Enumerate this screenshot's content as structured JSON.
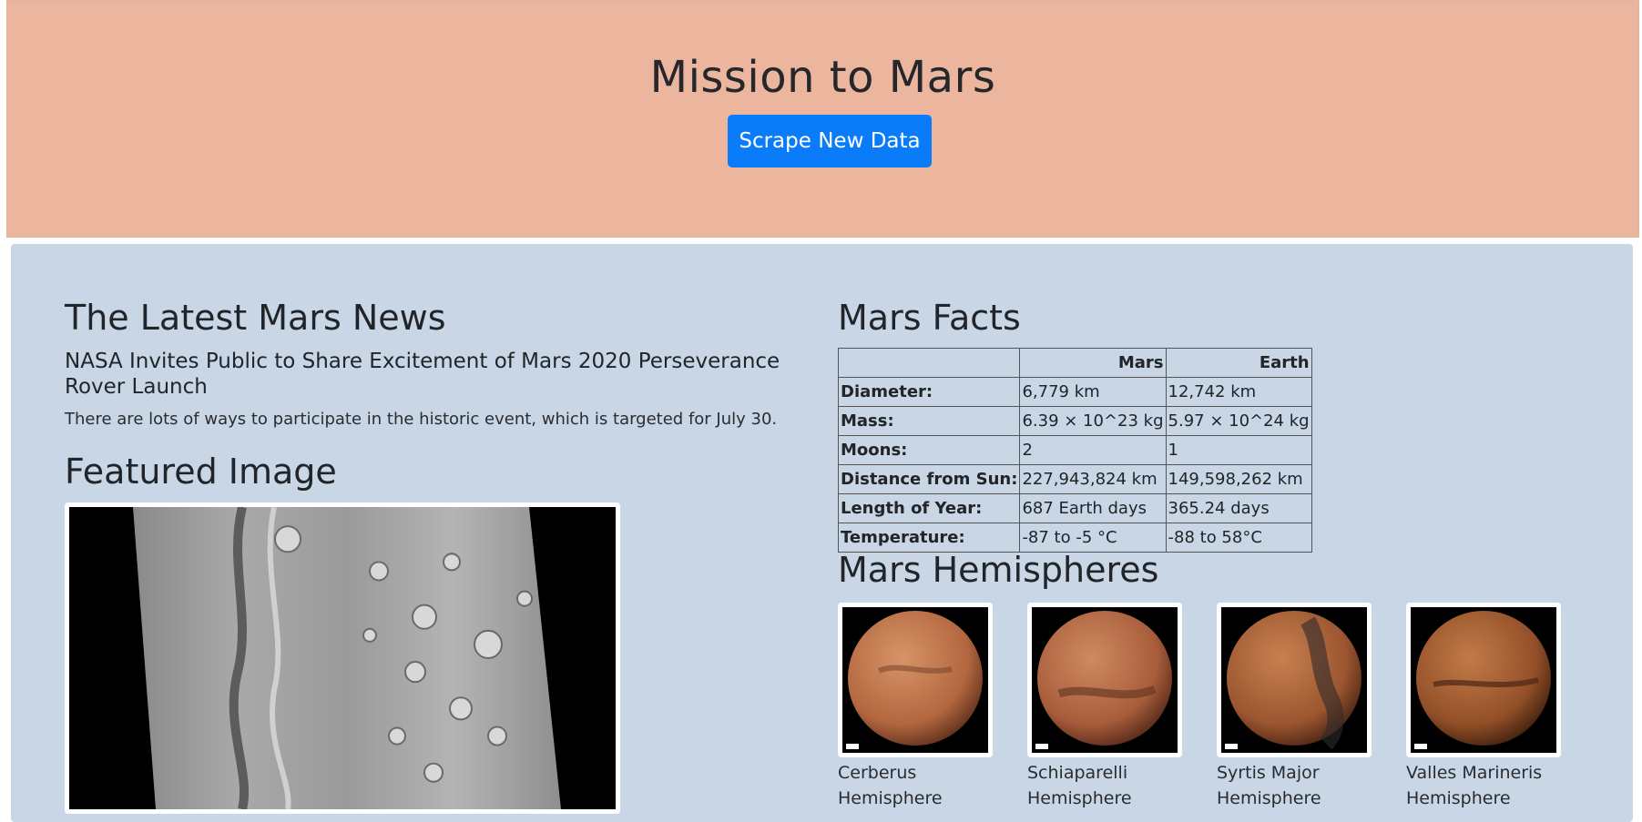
{
  "header": {
    "title": "Mission to Mars",
    "scrape_button": "Scrape New Data"
  },
  "news": {
    "heading": "The Latest Mars News",
    "title": "NASA Invites Public to Share Excitement of Mars 2020 Perseverance Rover Launch",
    "paragraph": "There are lots of ways to participate in the historic event, which is targeted for July 30."
  },
  "featured": {
    "heading": "Featured Image"
  },
  "facts": {
    "heading": "Mars Facts",
    "columns": [
      "",
      "Mars",
      "Earth"
    ],
    "rows": [
      {
        "label": "Diameter:",
        "mars": "6,779 km",
        "earth": "12,742 km"
      },
      {
        "label": "Mass:",
        "mars": "6.39 × 10^23 kg",
        "earth": "5.97 × 10^24 kg"
      },
      {
        "label": "Moons:",
        "mars": "2",
        "earth": "1"
      },
      {
        "label": "Distance from Sun:",
        "mars": "227,943,824 km",
        "earth": "149,598,262 km"
      },
      {
        "label": "Length of Year:",
        "mars": "687 Earth days",
        "earth": "365.24 days"
      },
      {
        "label": "Temperature:",
        "mars": "-87 to -5 °C",
        "earth": "-88 to 58°C"
      }
    ]
  },
  "hemispheres": {
    "heading": "Mars Hemispheres",
    "items": [
      {
        "line1": "Cerberus",
        "line2": "Hemisphere"
      },
      {
        "line1": "Schiaparelli",
        "line2": "Hemisphere"
      },
      {
        "line1": "Syrtis Major",
        "line2": "Hemisphere"
      },
      {
        "line1": "Valles Marineris",
        "line2": "Hemisphere"
      }
    ]
  }
}
